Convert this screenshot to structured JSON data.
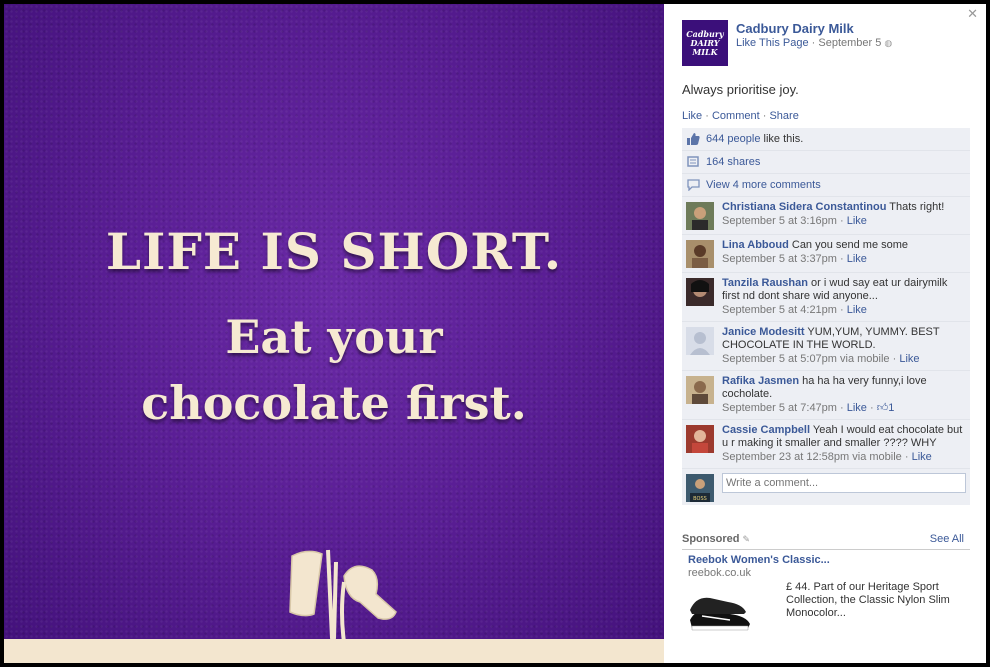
{
  "photo": {
    "line1": "LIFE IS SHORT.",
    "line2": "Eat your",
    "line3": "chocolate first."
  },
  "page": {
    "logo_text": "Cadbury DAIRY MILK",
    "name": "Cadbury Dairy Milk",
    "like_page": "Like This Page",
    "date": "September 5"
  },
  "post": {
    "text": "Always prioritise joy.",
    "actions": {
      "like": "Like",
      "comment": "Comment",
      "share": "Share"
    },
    "likes": {
      "count": "644 people",
      "suffix": "like this."
    },
    "shares": "164 shares",
    "view_more": "View 4 more comments"
  },
  "comments": [
    {
      "author": "Christiana Sidera Constantinou",
      "text": "Thats right!",
      "time": "September 5 at 3:16pm",
      "via": "",
      "like": "Like",
      "extra": ""
    },
    {
      "author": "Lina Abboud",
      "text": "Can you send me some",
      "time": "September 5 at 3:37pm",
      "via": "",
      "like": "Like",
      "extra": ""
    },
    {
      "author": "Tanzila Raushan",
      "text": "or i wud say eat ur dairymilk first nd dont share wid anyone...",
      "time": "September 5 at 4:21pm",
      "via": "",
      "like": "Like",
      "extra": ""
    },
    {
      "author": "Janice Modesitt",
      "text": "YUM,YUM, YUMMY. BEST CHOCOLATE IN THE WORLD.",
      "time": "September 5 at 5:07pm",
      "via": "via mobile",
      "like": "Like",
      "extra": ""
    },
    {
      "author": "Rafika Jasmen",
      "text": "ha ha ha very funny,i love cocholate.",
      "time": "September 5 at 7:47pm",
      "via": "",
      "like": "Like",
      "extra": "1"
    },
    {
      "author": "Cassie Campbell",
      "text": "Yeah I would eat chocolate but u r making it smaller and smaller ???? WHY",
      "time": "September 23 at 12:58pm",
      "via": "via mobile",
      "like": "Like",
      "extra": ""
    }
  ],
  "write_comment": {
    "placeholder": "Write a comment...",
    "avatar_caption": "BOSS"
  },
  "sponsored": {
    "label": "Sponsored",
    "see_all": "See All",
    "ad_title": "Reebok Women's Classic...",
    "ad_domain": "reebok.co.uk",
    "ad_body": "£ 44. Part of our Heritage Sport Collection, the Classic Nylon Slim Monocolor..."
  },
  "colors": {
    "brand_purple": "#4b1a86",
    "link_blue": "#3b5998",
    "ufi_bg": "#edeff4"
  },
  "icons": [
    "close-icon",
    "globe-icon",
    "thumbs-up-icon",
    "shares-icon",
    "comments-icon",
    "ad-feedback-icon"
  ]
}
